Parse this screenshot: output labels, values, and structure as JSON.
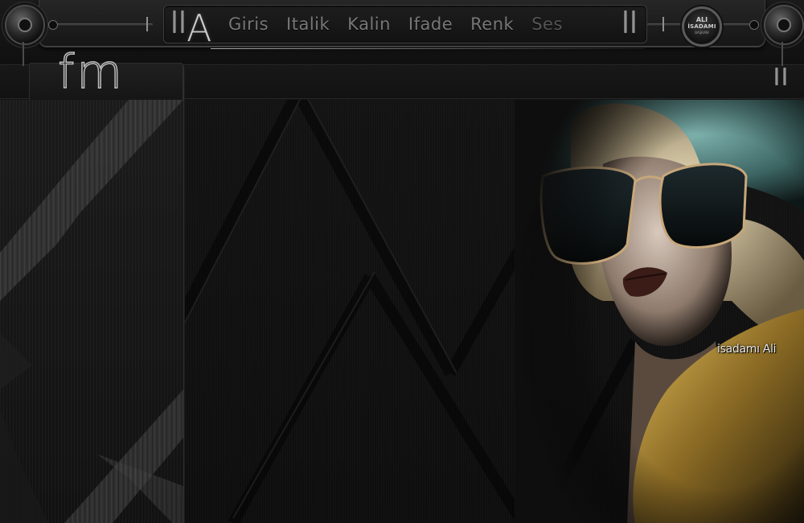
{
  "brand": {
    "logo_letter": "A",
    "site_logo": "fm",
    "emblem_lines": [
      "ALI",
      "İSADAMI",
      "BAŞKANI"
    ]
  },
  "nav": {
    "items": [
      "Giris",
      "Italik",
      "Kalin",
      "Ifade",
      "Renk",
      "Ses"
    ]
  },
  "indicators": {
    "left_marker": "i",
    "right_marker": "i"
  },
  "content": {
    "signature": "isadamı Ali"
  },
  "colors": {
    "background": "#0e0e0e",
    "nav_text": "#777777",
    "hat": "#5f8e8c",
    "hair": "#e6d7b5",
    "jacket": "#c9a64b"
  },
  "icons": [
    "pause-icon",
    "pause-icon",
    "knob-icon",
    "knob-icon",
    "emblem-icon"
  ]
}
